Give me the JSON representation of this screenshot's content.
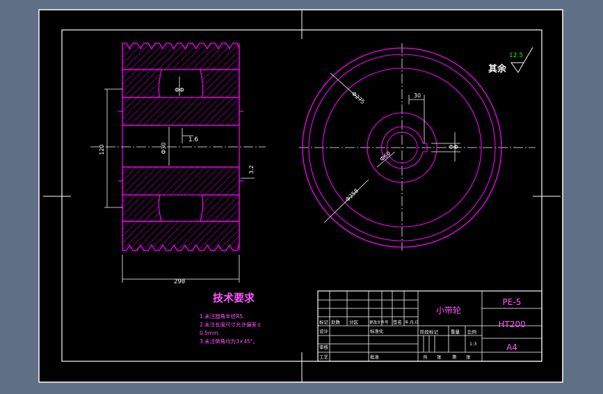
{
  "colors": {
    "background": "#5f6f85",
    "sheet": "#000000",
    "frame": "#ffffff",
    "geometry": "#ff00ff",
    "dim_text": "#ffffff",
    "title_accent": "#ff55ff",
    "green": "#00ff00"
  },
  "roughness": {
    "prefix": "其余",
    "value": "12.5"
  },
  "section_dims": {
    "width": "290",
    "outer_h": "120",
    "bore": "Ф30",
    "top": "ФФ",
    "roughness_mid": "1.6",
    "roughness_side": "3.2"
  },
  "front_dims": {
    "outer": "Ф275",
    "key_width": "30",
    "key_depth": "ФФ",
    "hub": "Ф60",
    "inner": "Ф258"
  },
  "tech": {
    "title": "技术要求",
    "lines": [
      "1.未注圆角半径R5.",
      "2.未注长度尺寸允许偏差±",
      "0.5mm.",
      "3.未注倒角均为3×45°。"
    ]
  },
  "title_block": {
    "part_name": "小带轮",
    "drawing_no": "PE-5",
    "material": "HT200",
    "size": "A4",
    "scale": "1:3",
    "headers": [
      "标记",
      "处数",
      "分区",
      "更改文件号",
      "签名",
      "年.月.日"
    ],
    "row_design": [
      "设计",
      "",
      "",
      "标准化"
    ],
    "row_review": "审核",
    "row_process": [
      "工艺",
      "",
      "",
      "批准"
    ],
    "stage_headers": [
      "阶段标记",
      "重量",
      "比例"
    ],
    "bottom_row": [
      "共",
      "张",
      "第",
      "张"
    ]
  }
}
